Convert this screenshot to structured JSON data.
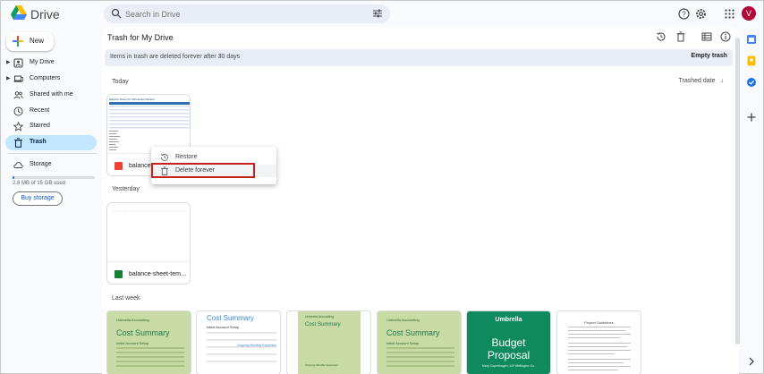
{
  "app": {
    "name": "Drive"
  },
  "search": {
    "placeholder": "Search in Drive"
  },
  "header": {
    "avatar_initial": "V"
  },
  "sidebar": {
    "new_label": "New",
    "items": [
      {
        "label": "My Drive"
      },
      {
        "label": "Computers"
      },
      {
        "label": "Shared with me"
      },
      {
        "label": "Recent"
      },
      {
        "label": "Starred"
      },
      {
        "label": "Trash"
      },
      {
        "label": "Storage"
      }
    ],
    "storage_text": "2.8 MB of 15 GB used",
    "storage_used_fraction": 0.0002,
    "buy_storage": "Buy storage"
  },
  "main": {
    "title": "Trash for My Drive",
    "banner": "Items in trash are deleted forever after 30 days",
    "empty_trash": "Empty trash",
    "sort_label": "Trashed date",
    "sections": {
      "today": "Today",
      "yesterday": "Yesterday",
      "last_week": "Last week"
    },
    "files": {
      "today_name": "balance-s",
      "yesterday_name": "balance-sheet-templat..."
    }
  },
  "context_menu": {
    "restore": "Restore",
    "delete_forever": "Delete forever"
  },
  "thumbnails": {
    "cost_summary_brand": "Umbrella Accounting",
    "cost_summary_title": "Cost Summary",
    "cost_summary_sub": "Initial Account Setup",
    "ongoing": "Ongoing Monthly Expenses",
    "budget_brand": "Umbrella",
    "budget_title1": "Budget",
    "budget_title2": "Proposal",
    "budget_sub": "Mary Copenhagen, 4/4 Wellington Co.",
    "doc_title": "Project Guidelines",
    "sheet_title": "Balance Sheet (for Wholesale Market)"
  },
  "colors": {
    "accent": "#0b57d0",
    "active_nav": "#c2e7ff",
    "highlight_box": "#c5221f",
    "green_card": "#c8dba5",
    "budget_green": "#0f8a5f"
  }
}
